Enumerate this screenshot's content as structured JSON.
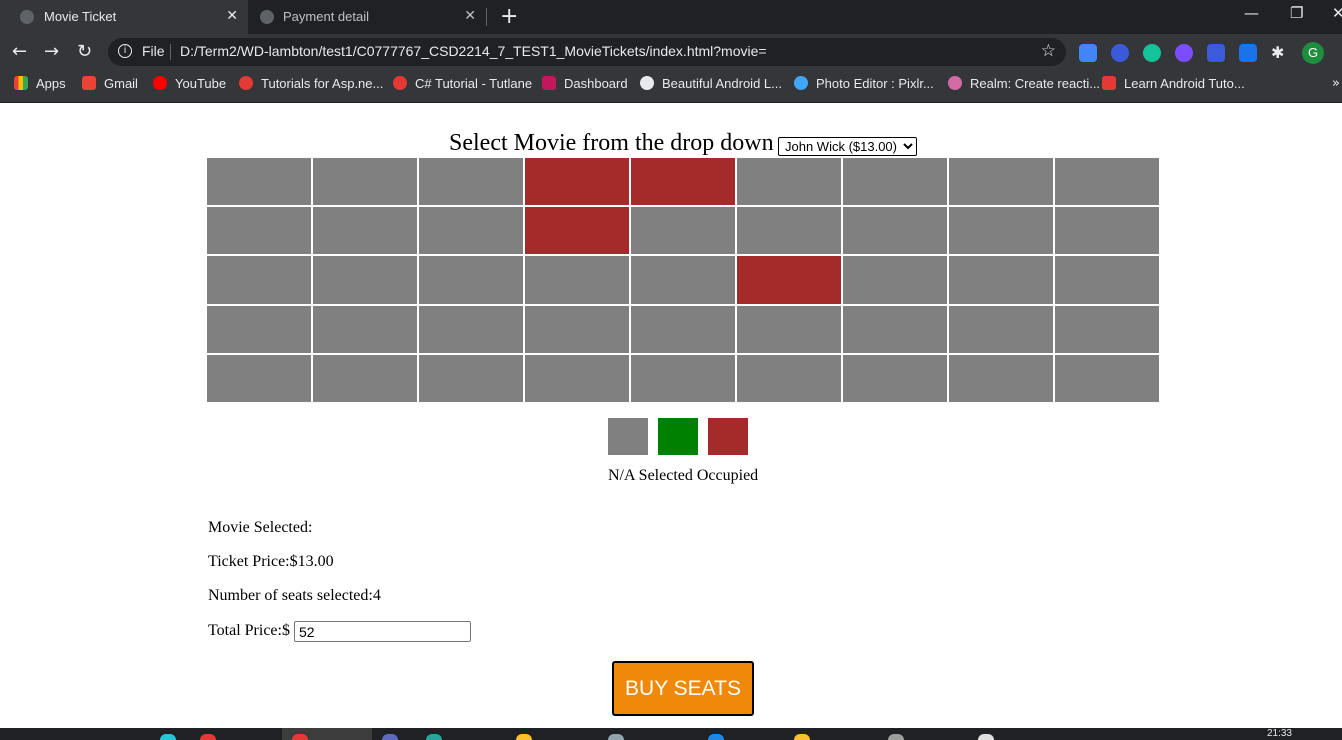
{
  "browser": {
    "tabs": [
      {
        "title": "Movie Ticket",
        "active": true
      },
      {
        "title": "Payment detail",
        "active": false
      }
    ],
    "new_tab_symbol": "+",
    "close_symbol": "✕",
    "url_scheme": "File",
    "url": "D:/Term2/WD-lambton/test1/C0777767_CSD2214_7_TEST1_MovieTickets/index.html?movie=",
    "profile_initial": "G",
    "bookmarks": [
      {
        "label": "Apps",
        "icon": "apps-grid-icon",
        "color": "#ea4335"
      },
      {
        "label": "Gmail",
        "icon": "gmail-icon",
        "color": "#ea4335"
      },
      {
        "label": "YouTube",
        "icon": "youtube-icon",
        "color": "#ff0000"
      },
      {
        "label": "Tutorials for Asp.ne...",
        "icon": "link-icon",
        "color": "#e53935"
      },
      {
        "label": "C# Tutorial - Tutlane",
        "icon": "link-icon",
        "color": "#e53935"
      },
      {
        "label": "Dashboard",
        "icon": "dashboard-icon",
        "color": "#c2185b"
      },
      {
        "label": "Beautiful Android L...",
        "icon": "globe-icon",
        "color": "#e8eaed"
      },
      {
        "label": "Photo Editor : Pixlr...",
        "icon": "pixlr-icon",
        "color": "#42a5f5"
      },
      {
        "label": "Realm: Create reacti...",
        "icon": "realm-icon",
        "color": "#d46ba6"
      },
      {
        "label": "Learn Android Tuto...",
        "icon": "vue-icon",
        "color": "#e53935"
      }
    ],
    "bookmarks_more": "»"
  },
  "page": {
    "heading": "Select Movie from the drop down",
    "movie_options": [
      "John Wick ($13.00)"
    ],
    "selected_movie": "John Wick ($13.00)",
    "seat_rows": [
      [
        "available",
        "available",
        "available",
        "occupied",
        "occupied",
        "available",
        "available",
        "available",
        "available"
      ],
      [
        "available",
        "available",
        "available",
        "occupied",
        "available",
        "available",
        "available",
        "available",
        "available"
      ],
      [
        "available",
        "available",
        "available",
        "available",
        "available",
        "occupied",
        "available",
        "available",
        "available"
      ],
      [
        "available",
        "available",
        "available",
        "available",
        "available",
        "available",
        "available",
        "available",
        "available"
      ],
      [
        "available",
        "available",
        "available",
        "available",
        "available",
        "available",
        "available",
        "available",
        "available"
      ]
    ],
    "colors": {
      "available": "#808080",
      "selected": "#008000",
      "occupied": "#a52a2a",
      "button": "#f0880a"
    },
    "legend_text": "N/A Selected Occupied",
    "movie_selected_label": "Movie Selected:",
    "ticket_price_label": "Ticket Price:$13.00",
    "seats_selected_label": "Number of seats selected:4",
    "total_price_label": "Total Price:$",
    "total_price_value": "52",
    "buy_button_label": "BUY SEATS"
  },
  "taskbar": {
    "clock": "21:33"
  }
}
